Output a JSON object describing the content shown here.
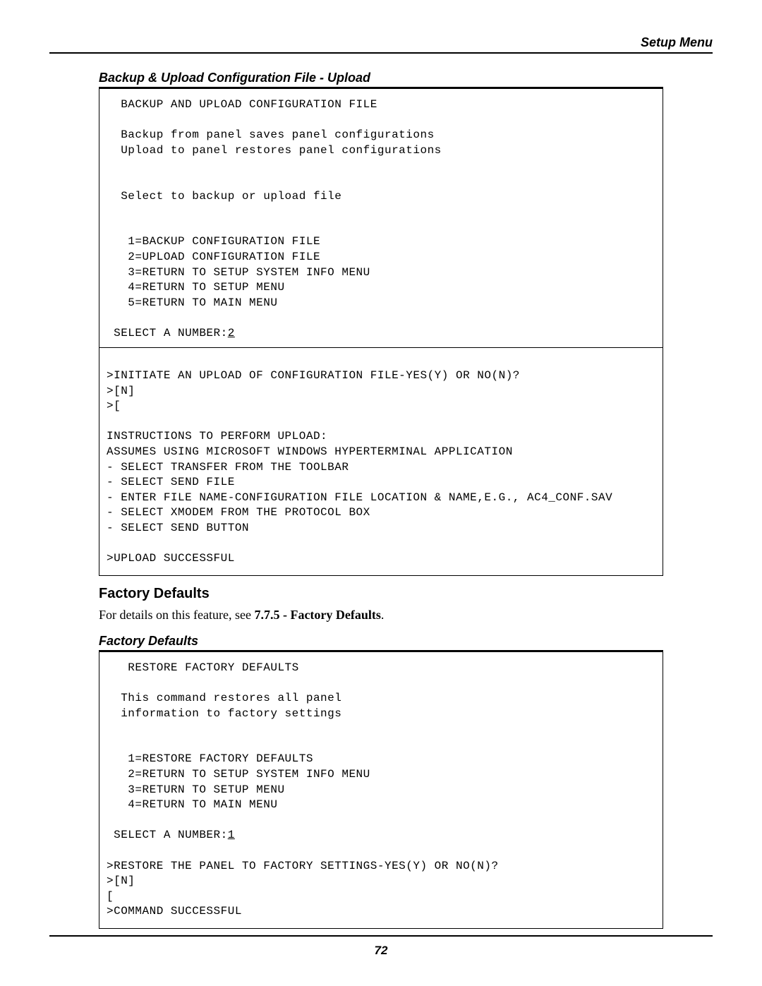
{
  "header": {
    "title": "Setup Menu"
  },
  "section1": {
    "title": "Backup & Upload Configuration File - Upload",
    "terminal": {
      "heading": "  BACKUP AND UPLOAD CONFIGURATION FILE",
      "desc1": "  Backup from panel saves panel configurations",
      "desc2": "  Upload to panel restores panel configurations",
      "select_prompt": "  Select to backup or upload file",
      "opt1": "   1=BACKUP CONFIGURATION FILE",
      "opt2": "   2=UPLOAD CONFIGURATION FILE",
      "opt3": "   3=RETURN TO SETUP SYSTEM INFO MENU",
      "opt4": "   4=RETURN TO SETUP MENU",
      "opt5": "   5=RETURN TO MAIN MENU",
      "select_label": " SELECT A NUMBER:",
      "select_value": "2",
      "initiate": ">INITIATE AN UPLOAD OF CONFIGURATION FILE-YES(Y) OR NO(N)?",
      "response1": ">[N]",
      "response2": ">[",
      "instr_title": "INSTRUCTIONS TO PERFORM UPLOAD:",
      "instr_assume": "ASSUMES USING MICROSOFT WINDOWS HYPERTERMINAL APPLICATION",
      "instr1": "- SELECT TRANSFER FROM THE TOOLBAR",
      "instr2": "- SELECT SEND FILE",
      "instr3": "- ENTER FILE NAME-CONFIGURATION FILE LOCATION & NAME,E.G., AC4_CONF.SAV",
      "instr4": "- SELECT XMODEM FROM THE PROTOCOL BOX",
      "instr5": "- SELECT SEND BUTTON",
      "result": ">UPLOAD SUCCESSFUL"
    }
  },
  "section2": {
    "title": "Factory Defaults",
    "body_prefix": "For details on this feature, see ",
    "body_ref": "7.7.5 - Factory Defaults",
    "body_suffix": ".",
    "sub_title": "Factory Defaults",
    "terminal": {
      "heading": "   RESTORE FACTORY DEFAULTS",
      "desc1": "  This command restores all panel",
      "desc2": "  information to factory settings",
      "opt1": "   1=RESTORE FACTORY DEFAULTS",
      "opt2": "   2=RETURN TO SETUP SYSTEM INFO MENU",
      "opt3": "   3=RETURN TO SETUP MENU",
      "opt4": "   4=RETURN TO MAIN MENU",
      "select_label": " SELECT A NUMBER:",
      "select_value": "1",
      "confirm": ">RESTORE THE PANEL TO FACTORY SETTINGS-YES(Y) OR NO(N)?",
      "response1": ">[N]",
      "response2": "[",
      "result": ">COMMAND SUCCESSFUL"
    }
  },
  "page_number": "72"
}
